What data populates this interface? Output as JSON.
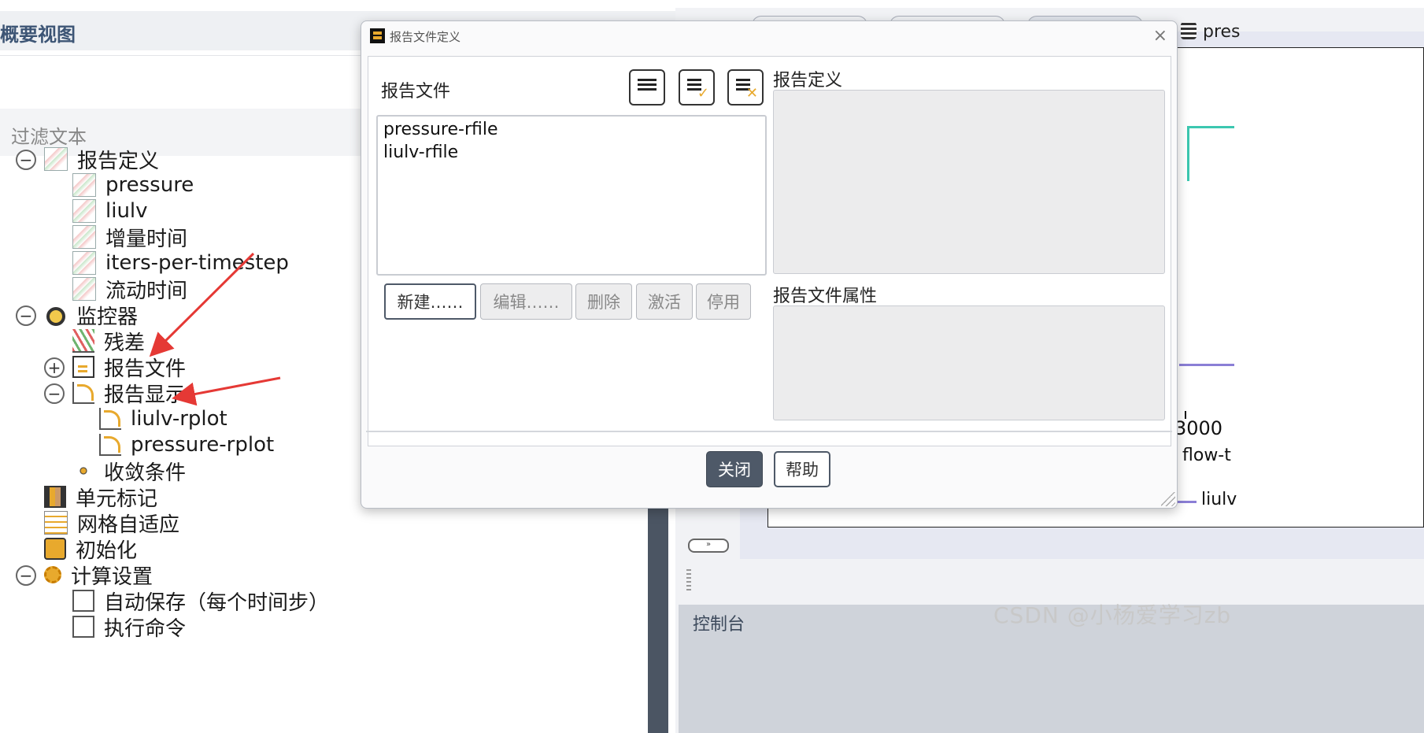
{
  "outline": {
    "title": "概要视图",
    "filter_placeholder": "过滤文本",
    "tree": {
      "report_definitions": "报告定义",
      "rd_items": [
        "pressure",
        "liulv",
        "增量时间",
        "iters-per-timestep",
        "流动时间"
      ],
      "monitors": "监控器",
      "residuals": "残差",
      "report_files": "报告文件",
      "report_plots": "报告显示",
      "plot_items": [
        "liulv-rplot",
        "pressure-rplot"
      ],
      "convergence": "收敛条件",
      "cell_registers": "单元标记",
      "mesh_adaption": "网格自适应",
      "initialization": "初始化",
      "calc_activities": "计算设置",
      "autosave": "自动保存（每个时间步）",
      "execute_commands": "执行命令"
    }
  },
  "dialog": {
    "title": "报告文件定义",
    "close_glyph": "×",
    "report_files_label": "报告文件",
    "files": [
      "pressure-rfile",
      "liulv-rfile"
    ],
    "buttons": {
      "new": "新建……",
      "edit": "编辑……",
      "delete": "删除",
      "activate": "激活",
      "deactivate": "停用"
    },
    "report_definitions_label": "报告定义",
    "report_file_properties_label": "报告文件属性",
    "close": "关闭",
    "help": "帮助"
  },
  "background": {
    "tab_label": "pres",
    "axis_tick": "3000",
    "axis_label": "flow-t",
    "legend_entry": "liulv",
    "console_label": "控制台",
    "watermark": "CSDN @小杨爱学习zb"
  },
  "colors": {
    "accent_dark": "#4e5968",
    "icon_orange": "#e8a92d",
    "annotation_arrow": "#e53935",
    "series_teal": "#3cc7b0",
    "series_purple": "#8b7fd6"
  }
}
